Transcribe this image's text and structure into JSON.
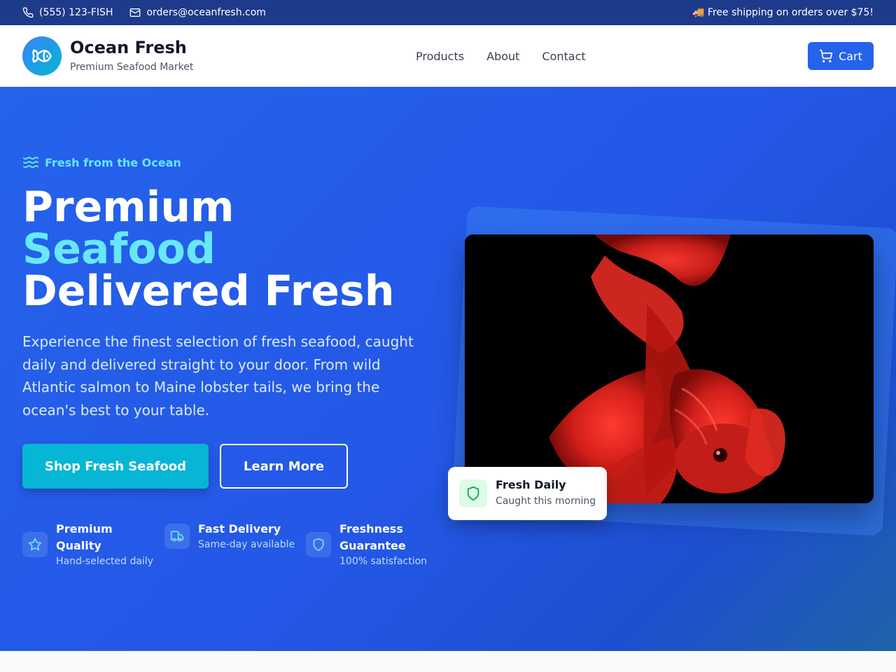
{
  "topbar": {
    "phone": "(555) 123-FISH",
    "email": "orders@oceanfresh.com",
    "shipping": "🚚 Free shipping on orders over $75!"
  },
  "header": {
    "brand_name": "Ocean Fresh",
    "brand_tagline": "Premium Seafood Market",
    "nav": [
      "Products",
      "About",
      "Contact"
    ],
    "cart_label": "Cart"
  },
  "hero": {
    "tag": "Fresh from the Ocean",
    "title_line1": "Premium",
    "title_line2": "Seafood",
    "title_line3": "Delivered Fresh",
    "description": "Experience the finest selection of fresh seafood, caught daily and delivered straight to your door. From wild Atlantic salmon to Maine lobster tails, we bring the ocean's best to your table.",
    "primary_cta": "Shop Fresh Seafood",
    "secondary_cta": "Learn More",
    "features": [
      {
        "icon": "star-icon",
        "title": "Premium Quality",
        "subtitle": "Hand-selected daily"
      },
      {
        "icon": "truck-icon",
        "title": "Fast Delivery",
        "subtitle": "Same-day available"
      },
      {
        "icon": "shield-icon",
        "title": "Freshness Guarantee",
        "subtitle": "100% satisfaction"
      }
    ],
    "badge": {
      "title": "Fresh Daily",
      "subtitle": "Caught this morning"
    }
  },
  "colors": {
    "topbar": "#1e3a8a",
    "primary": "#2563eb",
    "accent": "#67e8f9",
    "cta": "#06b6d4"
  }
}
